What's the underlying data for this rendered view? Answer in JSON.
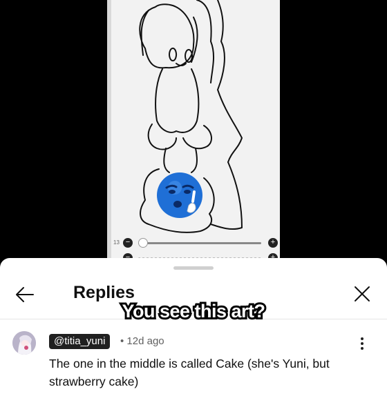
{
  "sheet": {
    "title": "Replies",
    "back_icon": "arrow-left-icon",
    "close_icon": "close-icon"
  },
  "overlay_caption": "You see this art?",
  "canvas": {
    "brush_size_label": "13"
  },
  "reply": {
    "author": "@titia_yuni",
    "time": "• 12d ago",
    "text": "The one in the middle is called Cake (she's Yuni, but strawberry cake)"
  },
  "colors": {
    "sheet_bg": "#ffffff",
    "chip_bg": "#202020",
    "emoji_blue": "#1f6fd6"
  }
}
